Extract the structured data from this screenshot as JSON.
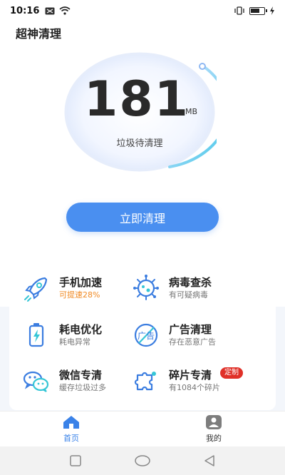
{
  "status": {
    "time": "10:16"
  },
  "app": {
    "title": "超神清理"
  },
  "gauge": {
    "value": "181",
    "unit": "MB",
    "caption": "垃圾待清理"
  },
  "action": {
    "clean_label": "立即清理"
  },
  "features": [
    {
      "title": "手机加速",
      "subtitle": "可提速28%",
      "icon": "rocket-icon"
    },
    {
      "title": "病毒查杀",
      "subtitle": "有可疑病毒",
      "icon": "virus-icon"
    },
    {
      "title": "耗电优化",
      "subtitle": "耗电异常",
      "icon": "battery-icon"
    },
    {
      "title": "广告清理",
      "subtitle": "存在恶意广告",
      "icon": "ad-icon"
    },
    {
      "title": "微信专清",
      "subtitle": "缓存垃圾过多",
      "icon": "wechat-icon"
    },
    {
      "title": "碎片专清",
      "subtitle": "有1084个碎片",
      "icon": "puzzle-icon",
      "badge": "定制"
    }
  ],
  "tabs": [
    {
      "label": "首页",
      "icon": "home-icon",
      "active": true
    },
    {
      "label": "我的",
      "icon": "profile-icon",
      "active": false
    }
  ],
  "colors": {
    "accent": "#4a8ff0",
    "orange": "#f08a24",
    "badge": "#e03028",
    "icon_blue": "#3b7de0"
  }
}
